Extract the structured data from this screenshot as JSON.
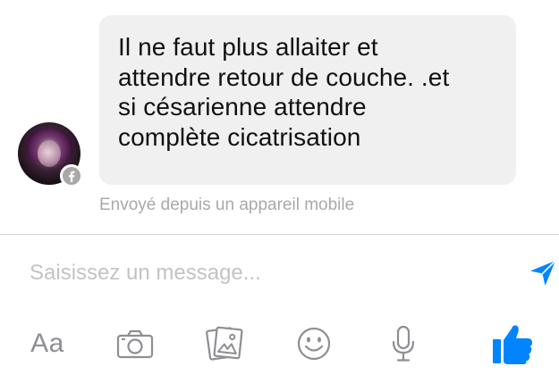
{
  "conversation": {
    "message": {
      "text": "Il ne faut plus allaiter et\nattendre retour de couche. .et\nsi césarienne attendre\ncomplète cicatrisation",
      "sent_from": "Envoyé depuis un appareil mobile",
      "source_badge_icon": "facebook-icon"
    }
  },
  "composer": {
    "placeholder": "Saisissez un message...",
    "value": ""
  },
  "toolbar": {
    "text_label": "Aa",
    "icons": [
      "camera-icon",
      "photo-gallery-icon",
      "smiley-icon",
      "microphone-icon",
      "thumbs-up-icon"
    ]
  },
  "colors": {
    "accent": "#0084ff",
    "bubble_bg": "#f1f0f0",
    "muted_text": "#a9a9ad",
    "icon_gray": "#8e8e93"
  }
}
